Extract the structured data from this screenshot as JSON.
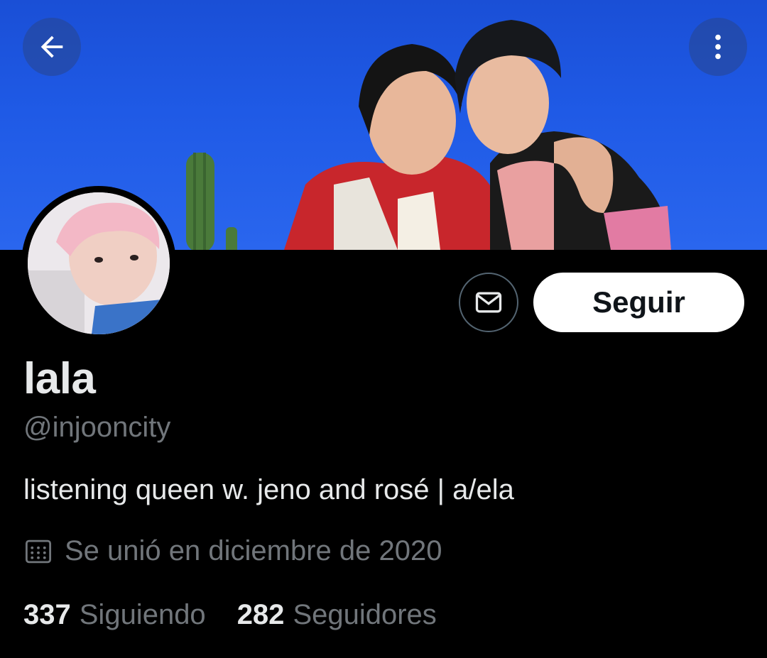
{
  "header": {
    "back_icon": "arrow-left-icon",
    "more_icon": "vertical-ellipsis-icon",
    "banner_color": "#1f5ae6"
  },
  "profile": {
    "display_name": "lala",
    "handle": "@injooncity",
    "bio": "listening queen w. jeno and rosé | a/ela",
    "joined_icon": "calendar-icon",
    "joined_text": "Se unió en diciembre de 2020"
  },
  "actions": {
    "message_icon": "envelope-icon",
    "follow_label": "Seguir"
  },
  "stats": [
    {
      "value": "337",
      "label": "Siguiendo"
    },
    {
      "value": "282",
      "label": "Seguidores"
    }
  ],
  "colors": {
    "background": "#000000",
    "primary_text": "#e7e9ea",
    "secondary_text": "#71767b",
    "button_bg": "#ffffff"
  }
}
